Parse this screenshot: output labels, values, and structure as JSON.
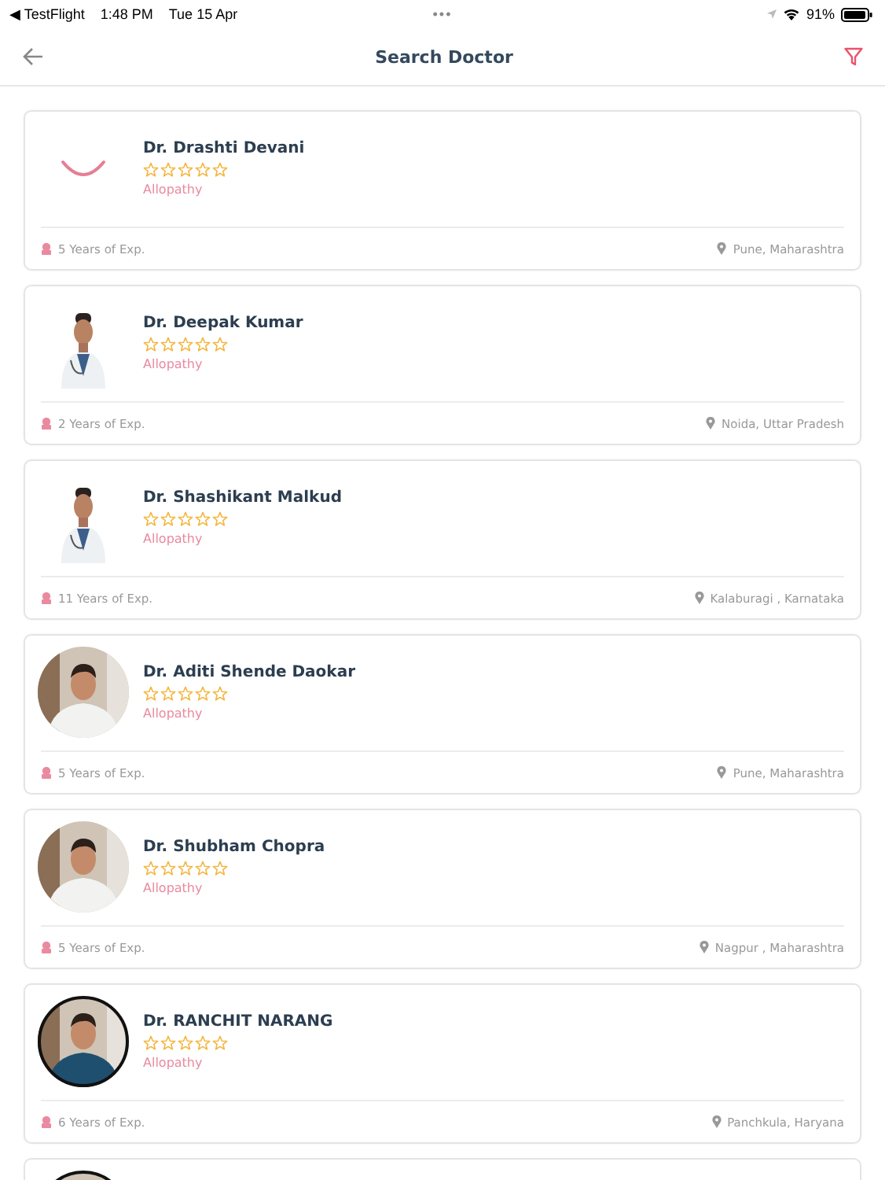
{
  "status_bar": {
    "back_app": "◀ TestFlight",
    "time": "1:48 PM",
    "date": "Tue 15 Apr",
    "dots": "•••",
    "battery_text": "91%"
  },
  "header": {
    "title": "Search Doctor"
  },
  "doctors": [
    {
      "name": "Dr. Drashti Devani",
      "stars": 0,
      "specialty": "Allopathy",
      "experience": "5 Years of Exp.",
      "location": "Pune, Maharashtra",
      "kind": "loading"
    },
    {
      "name": "Dr. Deepak Kumar",
      "stars": 0,
      "specialty": "Allopathy",
      "experience": "2 Years of Exp.",
      "location": "Noida, Uttar Pradesh",
      "kind": "cutout"
    },
    {
      "name": "Dr. Shashikant Malkud",
      "stars": 0,
      "specialty": "Allopathy",
      "experience": "11 Years of Exp.",
      "location": "Kalaburagi , Karnataka",
      "kind": "cutout"
    },
    {
      "name": "Dr. Aditi Shende Daokar",
      "stars": 0,
      "specialty": "Allopathy",
      "experience": "5 Years of Exp.",
      "location": "Pune, Maharashtra",
      "kind": "round"
    },
    {
      "name": "Dr. Shubham Chopra",
      "stars": 0,
      "specialty": "Allopathy",
      "experience": "5 Years of Exp.",
      "location": "Nagpur , Maharashtra",
      "kind": "round"
    },
    {
      "name": "Dr. RANCHIT NARANG",
      "stars": 0,
      "specialty": "Allopathy",
      "experience": "6 Years of Exp.",
      "location": "Panchkula, Haryana",
      "kind": "ringed"
    }
  ],
  "partial_card": {
    "kind": "ringed"
  }
}
